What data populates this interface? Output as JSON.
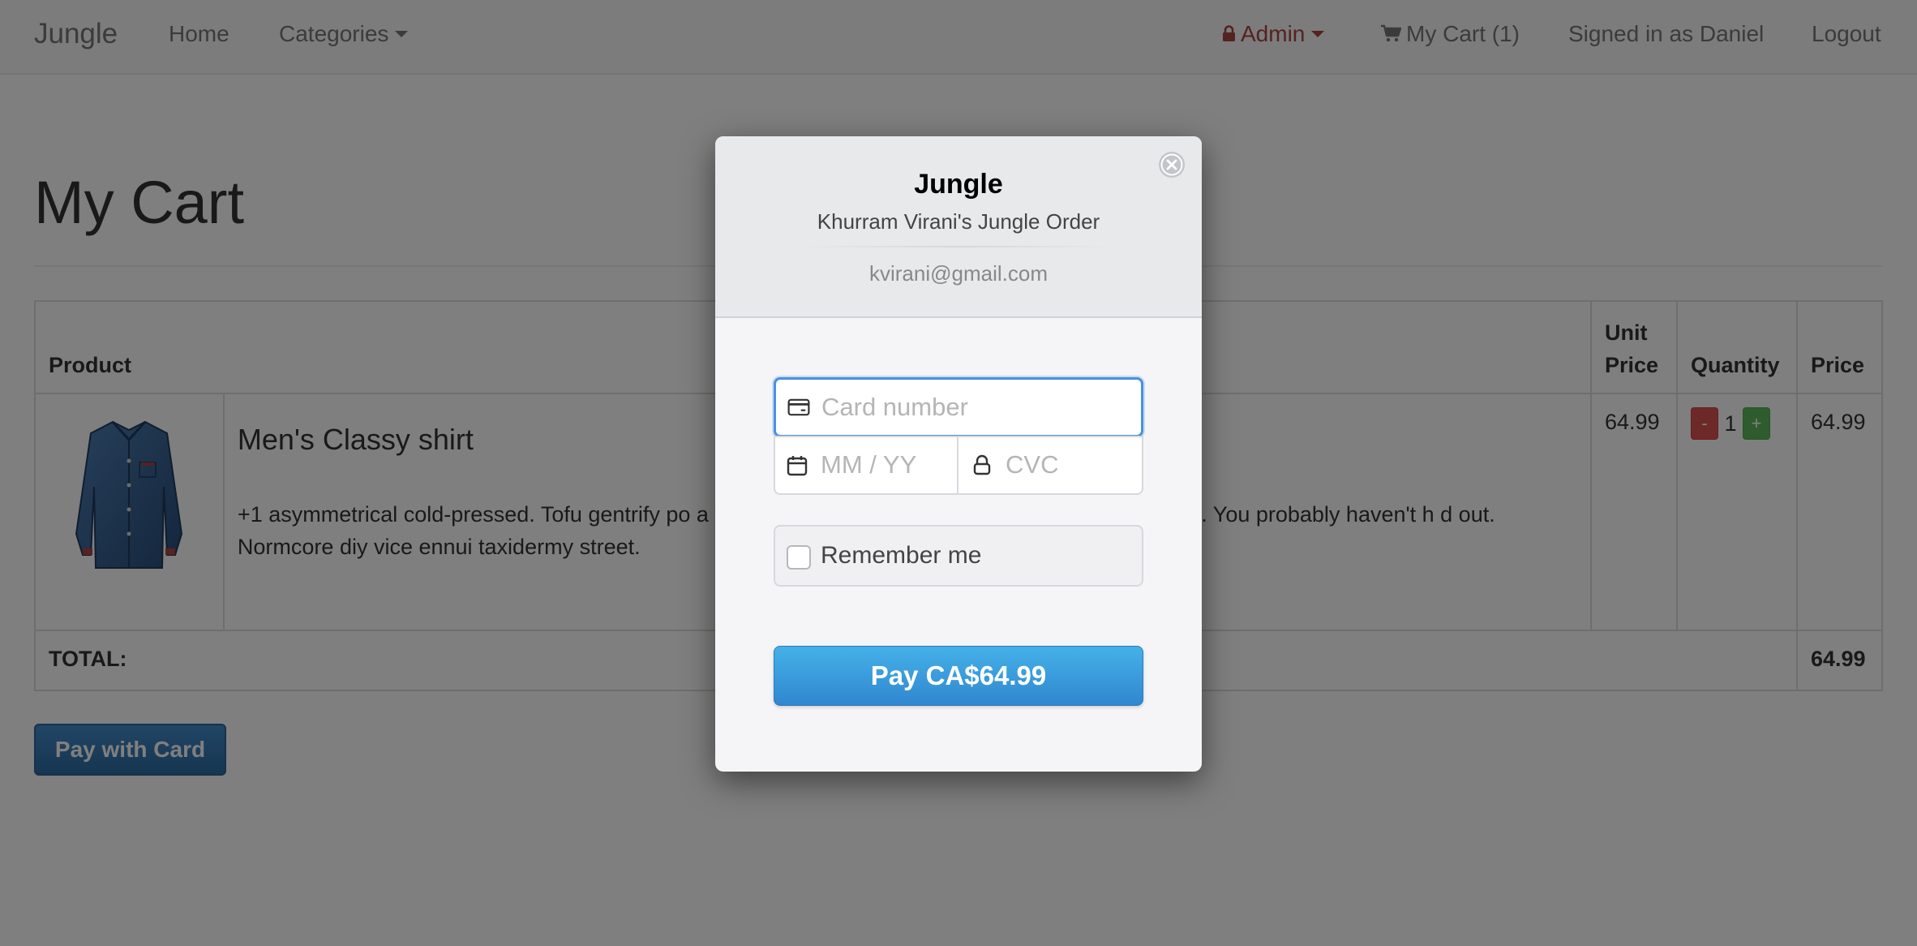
{
  "nav": {
    "brand": "Jungle",
    "home": "Home",
    "categories": "Categories",
    "admin": "Admin",
    "cart": "My Cart (1)",
    "signed_in": "Signed in as Daniel",
    "logout": "Logout"
  },
  "page": {
    "title": "My Cart"
  },
  "table": {
    "headers": {
      "product": "Product",
      "unit_price": "Unit Price",
      "quantity": "Quantity",
      "price": "Price"
    },
    "rows": [
      {
        "name": "Men's Classy shirt",
        "description": "+1 asymmetrical cold-pressed. Tofu gentrify po a vinyl portland art party roof meggings plaid truffaut. You probably haven't h d out. Normcore diy vice ennui taxidermy street.",
        "unit_price": "64.99",
        "quantity": "1",
        "minus_label": "-",
        "plus_label": "+",
        "price": "64.99"
      }
    ],
    "total_label": "TOTAL:",
    "total_value": "64.99"
  },
  "pay_with_card": "Pay with Card",
  "modal": {
    "title": "Jungle",
    "subtitle": "Khurram Virani's Jungle Order",
    "email": "kvirani@gmail.com",
    "card_number_placeholder": "Card number",
    "expiry_placeholder": "MM / YY",
    "cvc_placeholder": "CVC",
    "remember_label": "Remember me",
    "pay_button": "Pay CA$64.99"
  },
  "icons": {
    "lock": "lock-icon",
    "cart": "cart-icon",
    "card": "credit-card-icon",
    "calendar": "calendar-icon",
    "cvc_lock": "lock-icon",
    "close": "close-icon"
  },
  "colors": {
    "admin": "#a94442",
    "pay_with_card": "#337ab7",
    "pay_button": "#3b9bdc",
    "qty_minus": "#d9534f",
    "qty_plus": "#5cb85c",
    "focus_border": "#4a90e2"
  }
}
